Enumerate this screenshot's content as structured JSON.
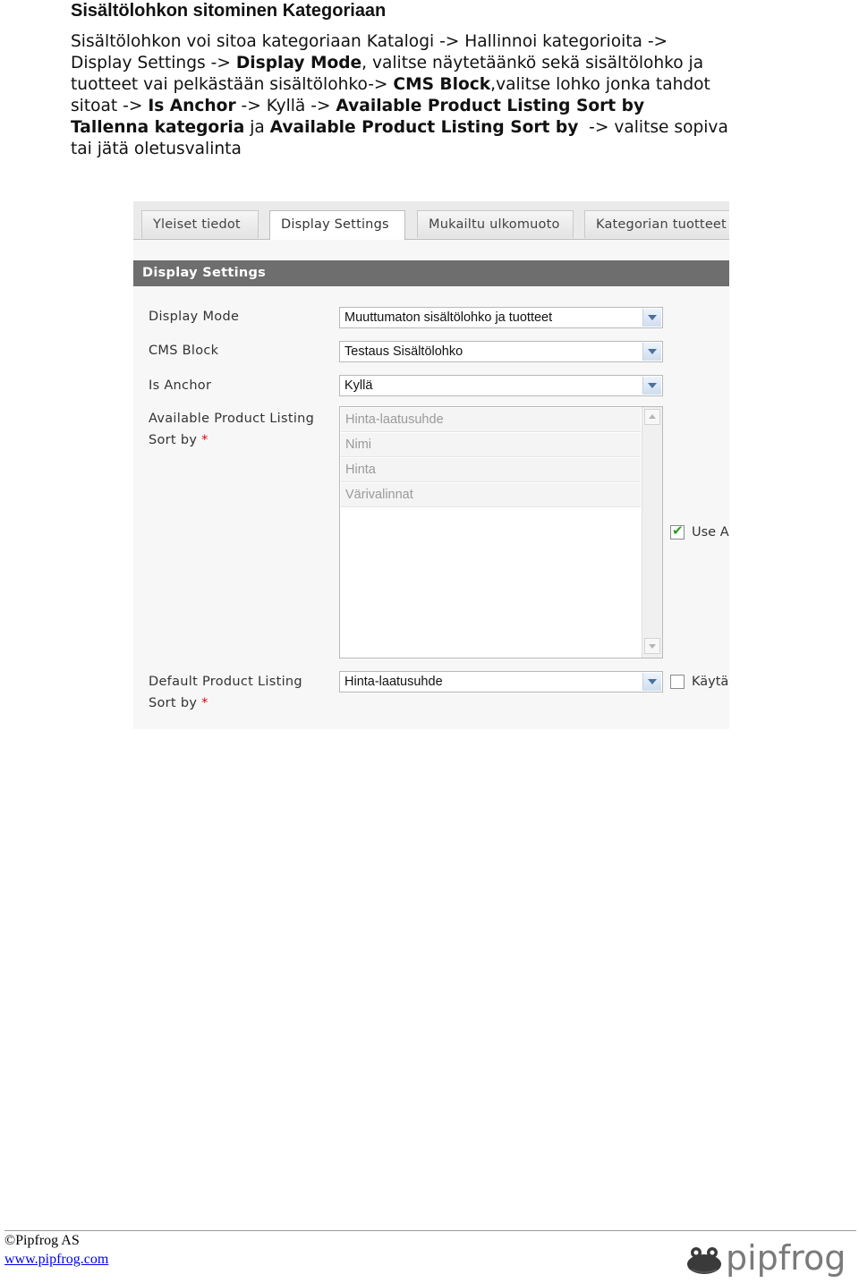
{
  "doc": {
    "heading": "Sisältölohkon sitominen Kategoriaan",
    "para": {
      "l1": "Sisältölohkon voi sitoa kategoriaan Katalogi -> Hallinnoi kategorioita ->",
      "l2a": "Display Settings -> ",
      "l2b": "Display Mode",
      "l2c": ", valitse näytetäänkö sekä sisältölohko ja",
      "l3a": "tuotteet vai pelkästään sisältölohko-> ",
      "l3b": "CMS Block",
      "l3c": ",valitse lohko jonka tahdot",
      "l4a": "sitoat -> ",
      "l4b": "Is Anchor",
      "l4c": " -> Kyllä -> ",
      "l4d": "Available Product Listing Sort by",
      "l5a": "Tallenna kategoria",
      "l5b": " ja ",
      "l5c": "Available Product Listing Sort by",
      "l5d": "  -> valitse sopiva",
      "l6": "tai jätä oletusvalinta"
    }
  },
  "screenshot": {
    "tabs": [
      "Yleiset tiedot",
      "Display Settings",
      "Mukailtu ulkomuoto",
      "Kategorian tuotteet"
    ],
    "active_tab": "Display Settings",
    "section_title": "Display Settings",
    "fields": {
      "display_mode": {
        "label": "Display Mode",
        "value": "Muuttumaton sisältölohko ja tuotteet"
      },
      "cms_block": {
        "label": "CMS Block",
        "value": "Testaus Sisältölohko"
      },
      "is_anchor": {
        "label": "Is Anchor",
        "value": "Kyllä"
      },
      "available_sort": {
        "label_line1": "Available Product Listing",
        "label_line2": "Sort by",
        "required_mark": "*",
        "options": [
          "Hinta-laatusuhde",
          "Nimi",
          "Hinta",
          "Värivalinnat"
        ],
        "use_all_label": "Use A",
        "use_all_checked": true
      },
      "default_sort": {
        "label_line1": "Default Product Listing",
        "label_line2": "Sort by",
        "required_mark": "*",
        "value": "Hinta-laatusuhde",
        "use_config_label": "Käytä",
        "use_config_checked": false
      }
    }
  },
  "footer": {
    "copyright": "©Pipfrog AS",
    "url": "www.pipfrog.com",
    "logo_text": "pipfrog",
    "logo_color": "#7a7a7a"
  }
}
